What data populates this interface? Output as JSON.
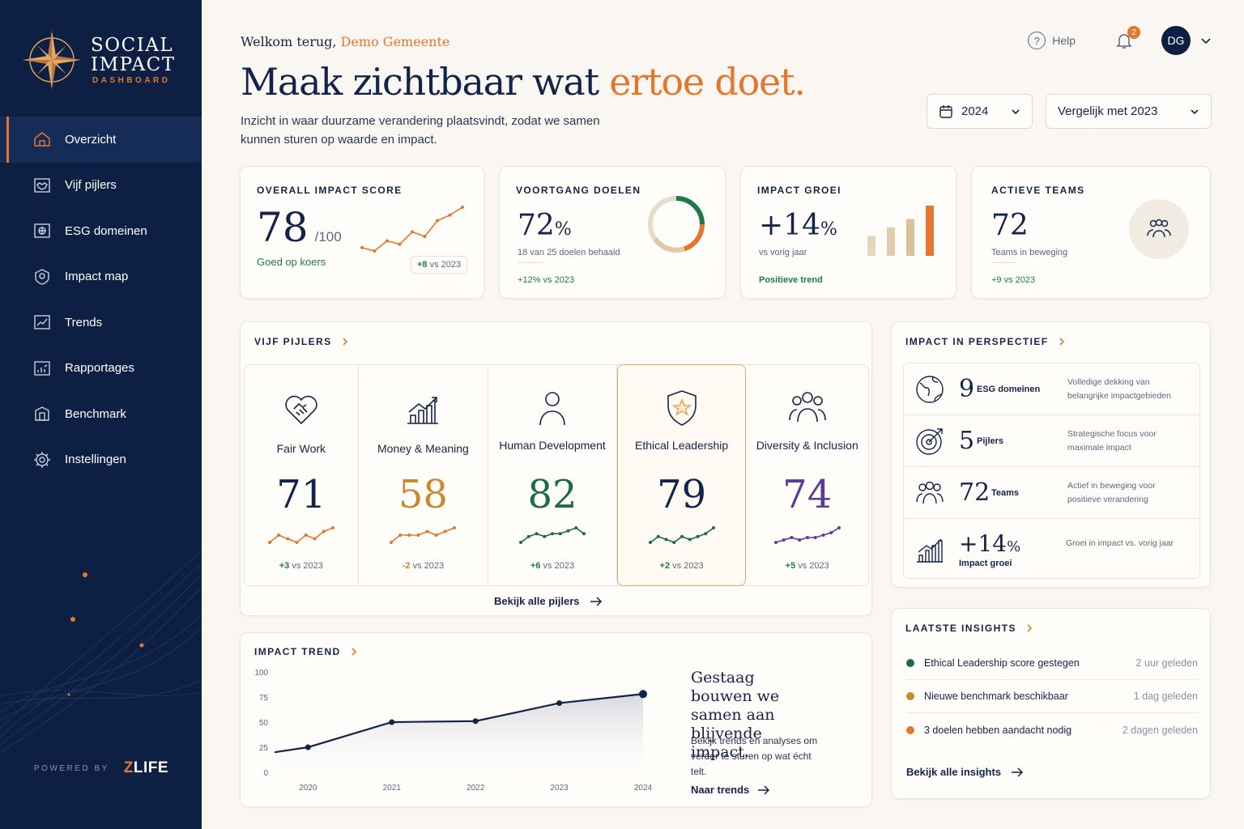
{
  "brand": {
    "line1": "SOCIAL",
    "line2": "IMPACT",
    "sub": "DASHBOARD",
    "powered_label": "POWERED BY",
    "powered_name_a": "Z",
    "powered_name_b": "LIFE"
  },
  "nav": [
    {
      "label": "Overzicht",
      "icon": "home-icon",
      "active": true
    },
    {
      "label": "Vijf pijlers",
      "icon": "pillars-icon"
    },
    {
      "label": "ESG domeinen",
      "icon": "esg-icon"
    },
    {
      "label": "Impact map",
      "icon": "map-icon"
    },
    {
      "label": "Trends",
      "icon": "trends-icon"
    },
    {
      "label": "Rapportages",
      "icon": "report-icon"
    },
    {
      "label": "Benchmark",
      "icon": "benchmark-icon"
    },
    {
      "label": "Instellingen",
      "icon": "gear-icon"
    }
  ],
  "header": {
    "welcome_prefix": "Welkom terug,",
    "welcome_name": "Demo Gemeente",
    "headline_a": "Maak zichtbaar wat ",
    "headline_b": "ertoe doet.",
    "subline": "Inzicht in waar duurzame verandering plaatsvindt, zodat we samen kunnen sturen op waarde en impact.",
    "help": "Help",
    "notifications": "2",
    "avatar": "DG",
    "year": "2024",
    "compare": "Vergelijk met 2023"
  },
  "kpis": {
    "overall": {
      "title": "OVERALL IMPACT SCORE",
      "value": "78",
      "unit": "/100",
      "status": "Goed op koers",
      "delta": "+8",
      "delta_suffix": "vs 2023",
      "trend": [
        34,
        31,
        40,
        37,
        48,
        44,
        58,
        63,
        70
      ]
    },
    "goals": {
      "title": "VOORTGANG DOELEN",
      "value": "72",
      "unit": "%",
      "caption": "18 van 25 doelen behaald",
      "delta": "+12%",
      "delta_suffix": "vs 2023",
      "progress": 0.72
    },
    "growth": {
      "title": "IMPACT GROEI",
      "value": "+14",
      "unit": "%",
      "caption": "vs vorig jaar",
      "trend_label": "Positieve trend",
      "bars": [
        24,
        34,
        44,
        60
      ]
    },
    "teams": {
      "title": "ACTIEVE TEAMS",
      "value": "72",
      "caption": "Teams in beweging",
      "delta": "+9",
      "delta_suffix": "vs 2023"
    }
  },
  "pillars": {
    "title": "VIJF PIJLERS",
    "link": "Bekijk alle pijlers",
    "items": [
      {
        "name": "Fair Work",
        "score": "71",
        "delta": "+3",
        "suffix": "vs 2023",
        "color": "#14234a",
        "spark_color": "#e2772d",
        "spark": [
          3,
          5,
          4,
          3,
          5,
          4,
          6,
          7
        ]
      },
      {
        "name": "Money & Meaning",
        "score": "58",
        "delta": "-2",
        "suffix": "vs 2023",
        "color": "#c98a2b",
        "spark_color": "#e2772d",
        "spark": [
          3,
          5,
          5,
          5,
          6,
          5,
          6,
          7
        ]
      },
      {
        "name": "Human Development",
        "score": "82",
        "delta": "+6",
        "suffix": "vs 2023",
        "color": "#1e6b47",
        "spark_color": "#1e6b47",
        "spark": [
          3,
          5,
          6,
          5,
          6,
          6,
          7,
          8,
          6
        ]
      },
      {
        "name": "Ethical Leadership",
        "score": "79",
        "delta": "+2",
        "suffix": "vs 2023",
        "color": "#14234a",
        "spark_color": "#1e6b47",
        "spark": [
          4,
          6,
          5,
          4,
          6,
          5,
          6,
          7,
          9
        ]
      },
      {
        "name": "Diversity & Inclusion",
        "score": "74",
        "delta": "+5",
        "suffix": "vs 2023",
        "color": "#5b3a9a",
        "spark_color": "#5b3a9a",
        "spark": [
          3,
          4,
          5,
          4,
          5,
          5,
          6,
          7,
          9
        ]
      }
    ]
  },
  "trend": {
    "title": "IMPACT TREND",
    "heading": "Gestaag bouwen we samen aan blijvende impact.",
    "body": "Bekijk trends en analyses om verder te sturen op wat écht telt.",
    "link": "Naar trends",
    "chart_data": {
      "type": "area",
      "x": [
        "2020",
        "2021",
        "2022",
        "2023",
        "2024"
      ],
      "series": [
        {
          "values": [
            20,
            25,
            50,
            51,
            69,
            78
          ],
          "x_pos": [
            2019.6,
            2020,
            2021,
            2022,
            2023,
            2024
          ]
        }
      ],
      "y_ticks": [
        0,
        25,
        50,
        75,
        100
      ],
      "ylim": [
        0,
        100
      ]
    }
  },
  "perspective": {
    "title": "IMPACT IN PERSPECTIEF",
    "rows": [
      {
        "num": "9",
        "label": "ESG domeinen",
        "desc": "Volledige dekking van belangrijke impactgebieden",
        "icon": "globe-icon"
      },
      {
        "num": "5",
        "label": "Pijlers",
        "desc": "Strategische focus voor maximale impact",
        "icon": "target-icon"
      },
      {
        "num": "72",
        "label": "Teams",
        "desc": "Actief in beweging voor positieve verandering",
        "icon": "people-icon"
      },
      {
        "num": "+14",
        "unit": "%",
        "label": "Impact groei",
        "desc": "Groei in impact vs. vorig jaar",
        "icon": "growth-chart-icon"
      }
    ]
  },
  "insights": {
    "title": "LAATSTE INSIGHTS",
    "link": "Bekijk alle insights",
    "items": [
      {
        "text": "Ethical Leadership score gestegen",
        "time": "2 uur geleden",
        "color": "#1e6b47"
      },
      {
        "text": "Nieuwe benchmark beschikbaar",
        "time": "1 dag geleden",
        "color": "#c98a2b"
      },
      {
        "text": "3 doelen hebben aandacht nodig",
        "time": "2 dagen geleden",
        "color": "#e2772d"
      }
    ]
  }
}
